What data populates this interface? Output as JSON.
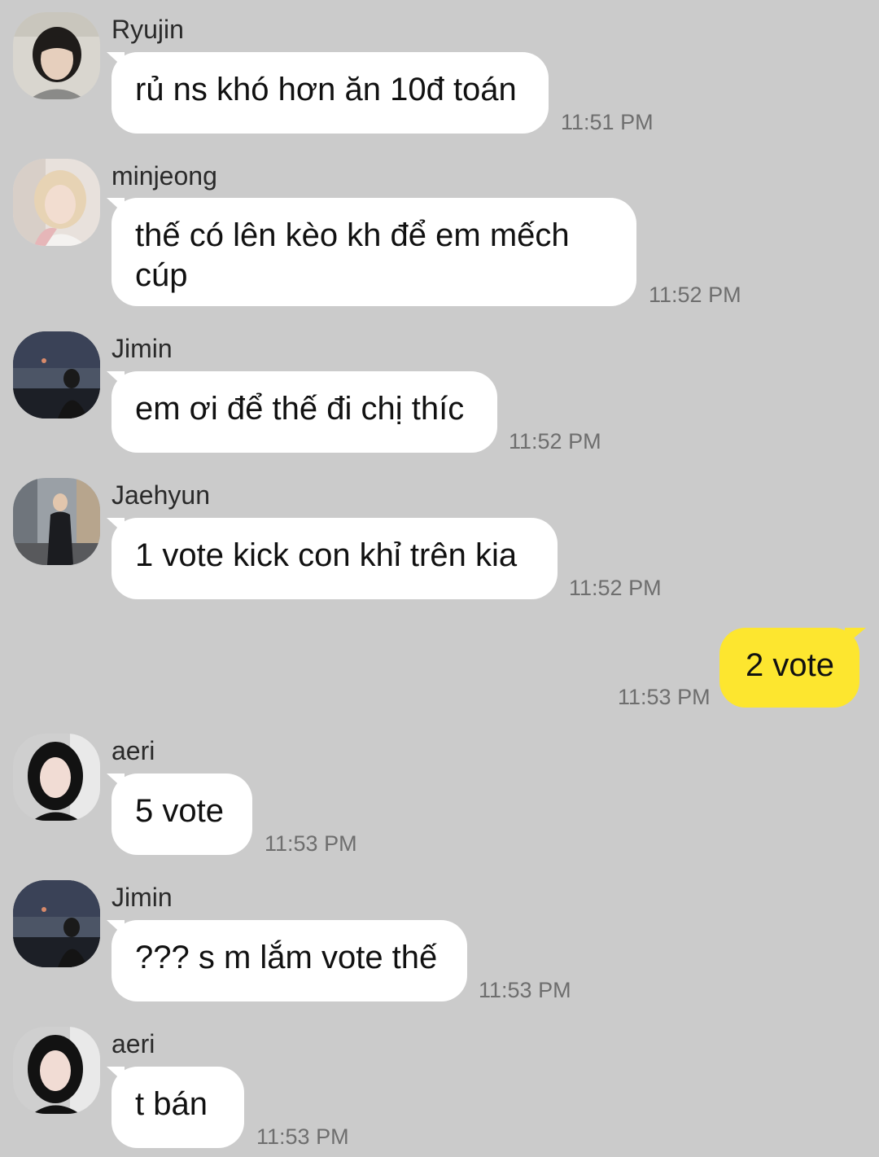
{
  "messages": [
    {
      "sender": "Ryujin",
      "text": "rủ ns khó hơn ăn 10đ toán",
      "time": "11:51 PM"
    },
    {
      "sender": "minjeong",
      "text": "thế có lên kèo kh để em mếch cúp",
      "time": "11:52 PM"
    },
    {
      "sender": "Jimin",
      "text": "em ơi để thế đi chị thíc",
      "time": "11:52 PM"
    },
    {
      "sender": "Jaehyun",
      "text": "1 vote kick con khỉ trên kia",
      "time": "11:52 PM"
    },
    {
      "sender": "",
      "text": "2 vote",
      "time": "11:53 PM",
      "outgoing": true
    },
    {
      "sender": "aeri",
      "text": "5 vote",
      "time": "11:53 PM"
    },
    {
      "sender": "Jimin",
      "text": "??? s m lắm vote thế",
      "time": "11:53 PM"
    },
    {
      "sender": "aeri",
      "text": "t bán",
      "time": "11:53 PM"
    }
  ],
  "colors": {
    "background": "#cbcbcb",
    "incoming_bubble": "#ffffff",
    "outgoing_bubble": "#fde62f",
    "timestamp": "#6e6e6e"
  }
}
